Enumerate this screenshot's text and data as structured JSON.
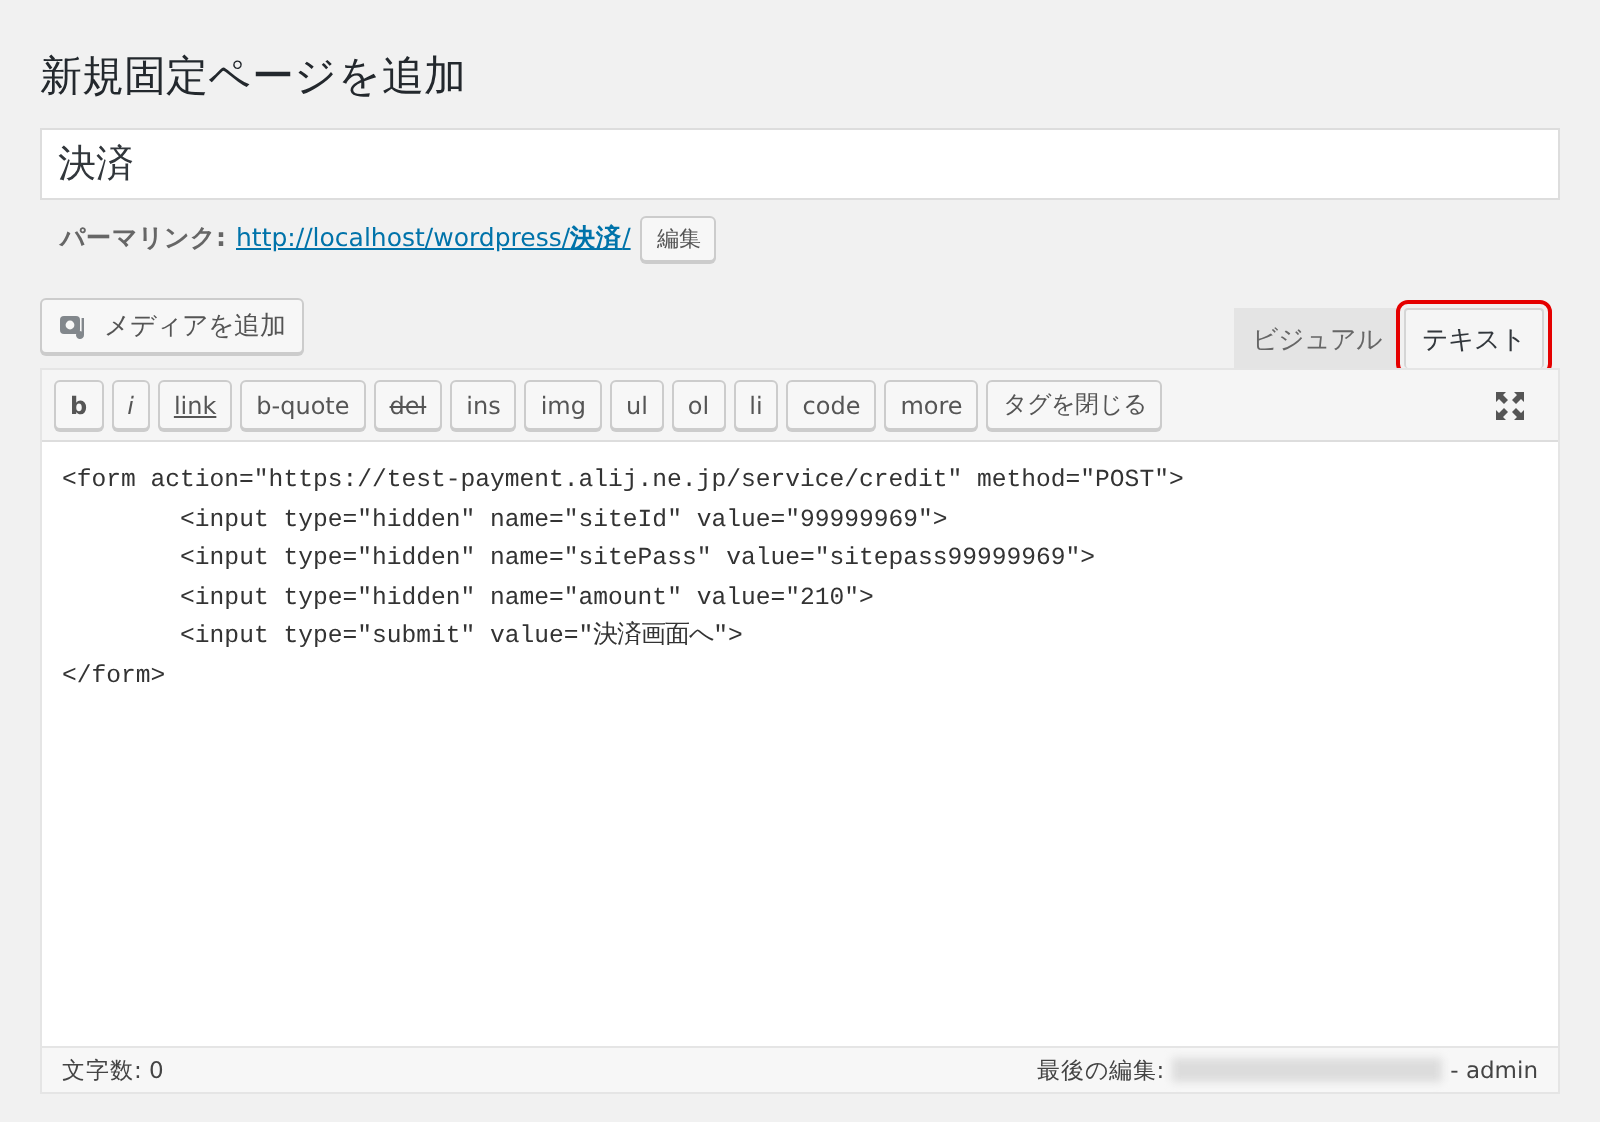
{
  "page_title": "新規固定ページを追加",
  "post_title": {
    "value": "決済"
  },
  "permalink": {
    "label": "パーマリンク:",
    "url_prefix": "http://localhost/wordpress/",
    "slug": "決済",
    "url_suffix": "/",
    "edit_button": "編集"
  },
  "media_button": "メディアを追加",
  "editor_tabs": [
    {
      "label": "ビジュアル",
      "selected": false,
      "highlighted": false
    },
    {
      "label": "テキスト",
      "selected": true,
      "highlighted": true
    }
  ],
  "quicktags": [
    {
      "label": "b",
      "kind": "bold"
    },
    {
      "label": "i",
      "kind": "italic"
    },
    {
      "label": "link",
      "kind": "underline"
    },
    {
      "label": "b-quote",
      "kind": "plain"
    },
    {
      "label": "del",
      "kind": "strike"
    },
    {
      "label": "ins",
      "kind": "plain"
    },
    {
      "label": "img",
      "kind": "plain"
    },
    {
      "label": "ul",
      "kind": "plain"
    },
    {
      "label": "ol",
      "kind": "plain"
    },
    {
      "label": "li",
      "kind": "plain"
    },
    {
      "label": "code",
      "kind": "plain"
    },
    {
      "label": "more",
      "kind": "plain"
    },
    {
      "label": "タグを閉じる",
      "kind": "plain"
    }
  ],
  "code_lines": [
    "<form action=\"https://test-payment.alij.ne.jp/service/credit\" method=\"POST\">",
    "\t<input type=\"hidden\" name=\"siteId\" value=\"99999969\">",
    "\t<input type=\"hidden\" name=\"sitePass\" value=\"sitepass99999969\">",
    "\t<input type=\"hidden\" name=\"amount\" value=\"210\">",
    "\t<input type=\"submit\" value=\"決済画面へ\">",
    "</form>"
  ],
  "status_bar": {
    "word_count": "文字数: 0",
    "last_edit_label": "最後の編集:",
    "last_edit_user": "- admin"
  }
}
